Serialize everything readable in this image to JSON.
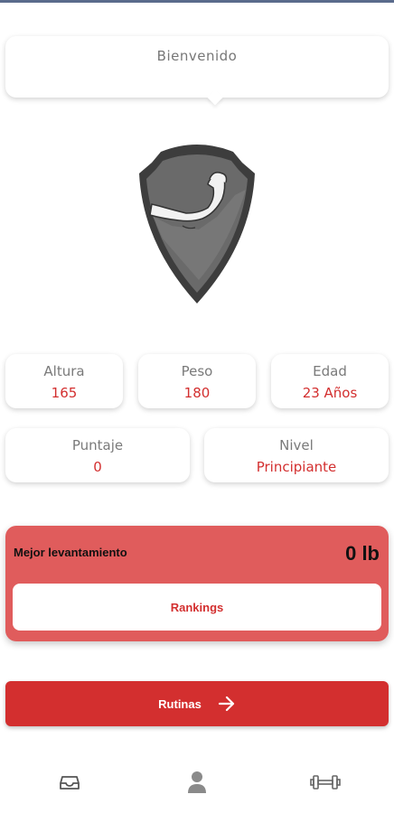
{
  "welcome": {
    "text": "Bienvenido"
  },
  "logo": {
    "icon": "muscle-shield-icon"
  },
  "stats": {
    "altura": {
      "label": "Altura",
      "value": "165"
    },
    "peso": {
      "label": "Peso",
      "value": "180"
    },
    "edad": {
      "label": "Edad",
      "value": "23 Años"
    },
    "puntaje": {
      "label": "Puntaje",
      "value": "0"
    },
    "nivel": {
      "label": "Nivel",
      "value": "Principiante"
    }
  },
  "best_lift": {
    "label": "Mejor levantamiento",
    "value": "0 lb",
    "rankings_label": "Rankings"
  },
  "routines": {
    "label": "Rutinas",
    "icon": "arrow-right-icon"
  },
  "nav": [
    {
      "icon": "inbox-icon"
    },
    {
      "icon": "profile-icon"
    },
    {
      "icon": "dumbbell-icon"
    }
  ],
  "colors": {
    "accent": "#d32f2f",
    "card_red": "#e05c5c",
    "label_gray": "#7a7a7a"
  }
}
